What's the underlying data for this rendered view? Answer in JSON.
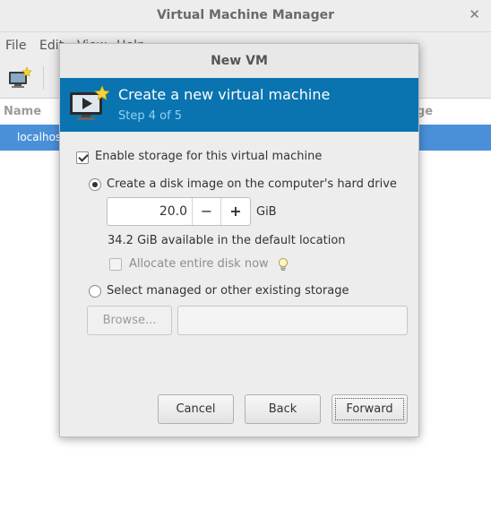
{
  "main_window": {
    "title": "Virtual Machine Manager",
    "close_glyph": "✕",
    "menu": [
      "File",
      "Edit",
      "View",
      "Help"
    ],
    "columns": {
      "name": "Name",
      "usage": "ge"
    },
    "connection_label": "localhost"
  },
  "dialog": {
    "title": "New VM",
    "banner": {
      "title": "Create a new virtual machine",
      "step": "Step 4 of 5",
      "icon": "new-vm-icon"
    },
    "enable_storage": {
      "label": "Enable storage for this virtual machine",
      "checked": true
    },
    "create_disk": {
      "label": "Create a disk image on the computer's hard drive",
      "selected": true
    },
    "disk_size": {
      "value": "20.0",
      "minus": "−",
      "plus": "+",
      "unit": "GiB"
    },
    "available_text": "34.2 GiB available in the default location",
    "allocate": {
      "label": "Allocate entire disk now",
      "checked": false,
      "hint_icon": "lightbulb-icon"
    },
    "select_existing": {
      "label": "Select managed or other existing storage",
      "selected": false
    },
    "browse_label": "Browse...",
    "path_value": "",
    "buttons": {
      "cancel": "Cancel",
      "back": "Back",
      "forward": "Forward"
    }
  },
  "colors": {
    "banner": "#0a74b0",
    "banner_step": "#8fd3f5",
    "selection": "#4a90d9"
  }
}
